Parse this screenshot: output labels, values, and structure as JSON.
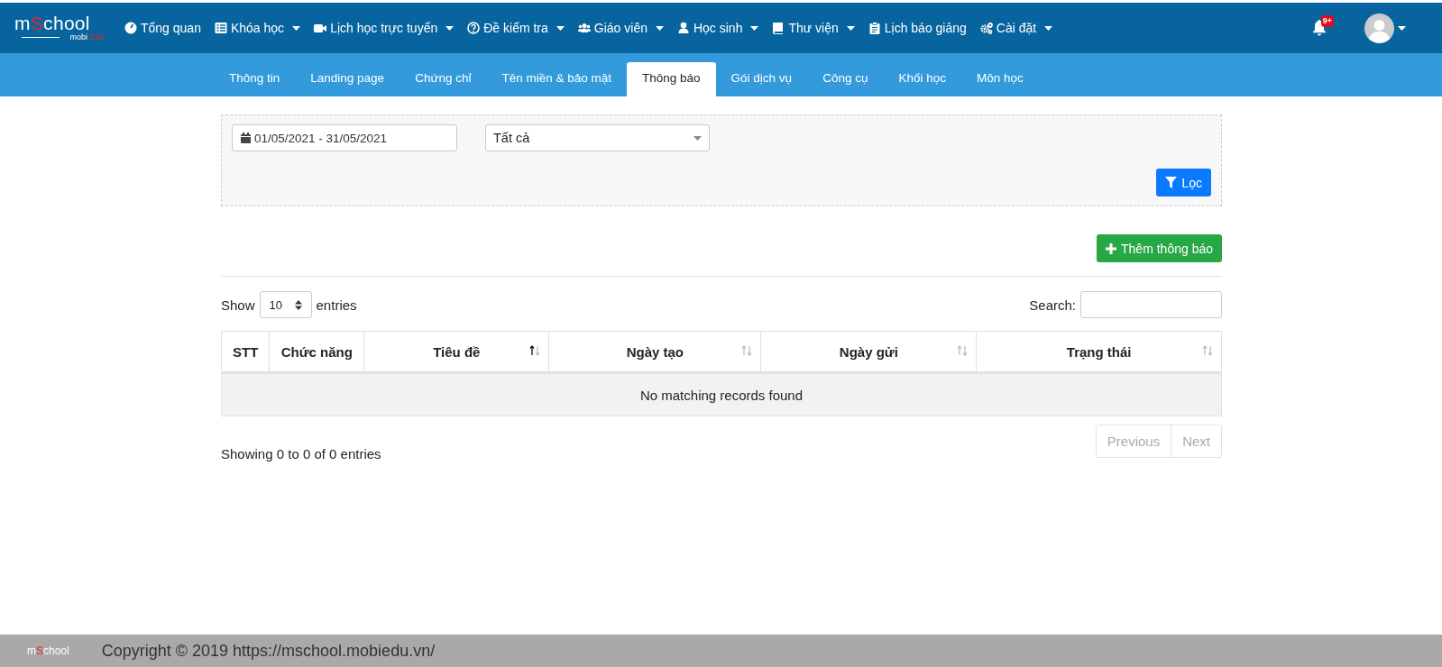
{
  "navbar": {
    "logo": {
      "parts": [
        {
          "text": "m",
          "accent": false
        },
        {
          "text": "S",
          "accent": true
        },
        {
          "text": "chool",
          "accent": false
        }
      ],
      "tagline": [
        {
          "text": "mobi",
          "accent": false
        },
        {
          "text": "Edu",
          "accent": true
        }
      ]
    },
    "items": [
      {
        "label": "Tổng quan",
        "kind": "gauge",
        "dropdown": false
      },
      {
        "label": "Khóa học",
        "kind": "list",
        "dropdown": true
      },
      {
        "label": "Lịch học trực tuyến",
        "kind": "video",
        "dropdown": true
      },
      {
        "label": "Đề kiểm tra",
        "kind": "question",
        "dropdown": true
      },
      {
        "label": "Giáo viên",
        "kind": "users",
        "dropdown": true
      },
      {
        "label": "Học sinh",
        "kind": "user",
        "dropdown": true
      },
      {
        "label": "Thư viện",
        "kind": "book",
        "dropdown": true
      },
      {
        "label": "Lịch báo giảng",
        "kind": "clipboard",
        "dropdown": false
      },
      {
        "label": "Cài đặt",
        "kind": "gears",
        "dropdown": true
      }
    ],
    "notifications": {
      "badge": "9+"
    }
  },
  "tabs": [
    {
      "label": "Thông tin",
      "selected": false
    },
    {
      "label": "Landing page",
      "selected": false
    },
    {
      "label": "Chứng chỉ",
      "selected": false
    },
    {
      "label": "Tên miền & bảo mật",
      "selected": false
    },
    {
      "label": "Thông báo",
      "selected": true
    },
    {
      "label": "Gói dịch vụ",
      "selected": false
    },
    {
      "label": "Công cụ",
      "selected": false
    },
    {
      "label": "Khối học",
      "selected": false
    },
    {
      "label": "Môn học",
      "selected": false
    }
  ],
  "filter": {
    "date_range": "01/05/2021 - 31/05/2021",
    "status_select": "Tất cả",
    "filter_button": "Lọc"
  },
  "add_button": "Thêm thông báo",
  "table": {
    "length_label_before": "Show",
    "length_value": "10",
    "length_label_after": "entries",
    "search_label": "Search:",
    "columns": [
      {
        "label": "STT",
        "sortable": false
      },
      {
        "label": "Chức năng",
        "sortable": false
      },
      {
        "label": "Tiêu đề",
        "sortable": true,
        "sorted": true
      },
      {
        "label": "Ngày tạo",
        "sortable": true,
        "sorted": false
      },
      {
        "label": "Ngày gửi",
        "sortable": true,
        "sorted": false
      },
      {
        "label": "Trạng thái",
        "sortable": true,
        "sorted": false
      }
    ],
    "empty_message": "No matching records found",
    "info": "Showing 0 to 0 of 0 entries",
    "pagination": [
      {
        "label": "Previous",
        "disabled": true
      },
      {
        "label": "Next",
        "disabled": true
      }
    ]
  },
  "footer": {
    "logo": [
      {
        "text": "m",
        "accent": false
      },
      {
        "text": "S",
        "accent": true
      },
      {
        "text": "chool",
        "accent": false
      }
    ],
    "copyright": "Copyright © 2019 https://mschool.mobiedu.vn/"
  }
}
